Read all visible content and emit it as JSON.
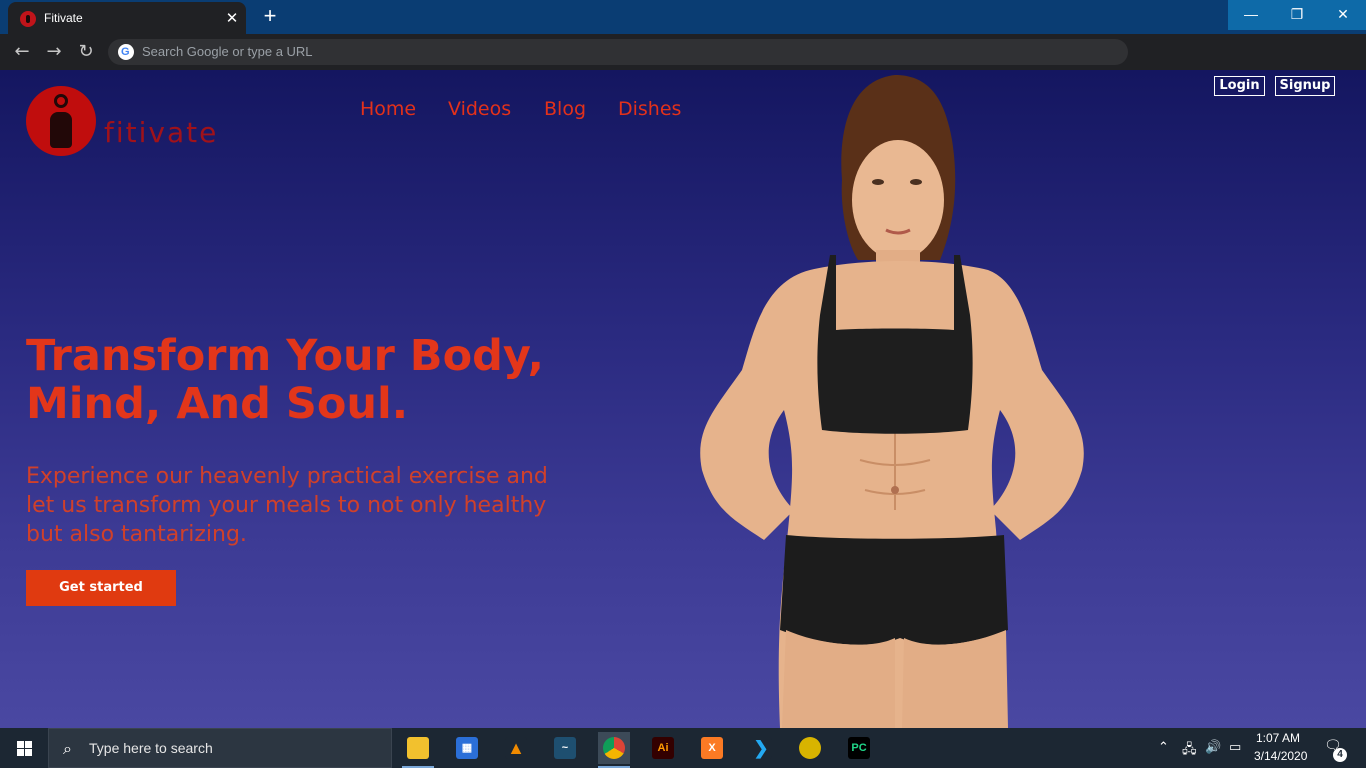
{
  "browser": {
    "tab_title": "Fitivate",
    "tab_close": "✕",
    "new_tab": "+",
    "omnibox_placeholder": "Search Google or type a URL",
    "window_controls": {
      "minimize": "—",
      "restore": "❐",
      "close": "✕"
    }
  },
  "site": {
    "logo_text": "fitivate",
    "nav": [
      "Home",
      "Videos",
      "Blog",
      "Dishes"
    ],
    "auth": {
      "login": "Login",
      "signup": "Signup"
    },
    "hero": {
      "title": "Transform Your Body, Mind, And Soul.",
      "subtitle": "Experience our heavenly practical exercise and let us transform your meals to not only healthy but also tantarizing.",
      "cta": "Get started"
    },
    "colors": {
      "accent": "#e3361a",
      "bg_top": "#141660",
      "bg_bottom": "#4a48a2",
      "cta_bg": "#e03a10",
      "logo": "#c00d0d"
    }
  },
  "taskbar": {
    "search_placeholder": "Type here to search",
    "apps": [
      "file-explorer-icon",
      "store-icon",
      "vlc-icon",
      "mysql-workbench-icon",
      "chrome-icon",
      "illustrator-icon",
      "xampp-icon",
      "vscode-icon",
      "game-icon",
      "pycharm-icon"
    ],
    "active_app": "chrome-icon",
    "clock": {
      "time": "1:07 AM",
      "date": "3/14/2020"
    },
    "notification_count": "4"
  }
}
